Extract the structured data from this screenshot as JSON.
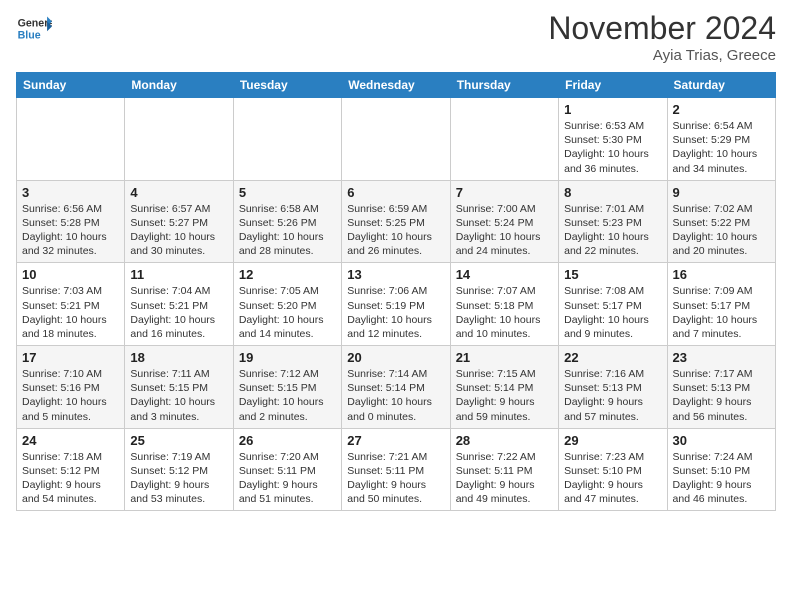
{
  "header": {
    "logo_line1": "General",
    "logo_line2": "Blue",
    "month_year": "November 2024",
    "location": "Ayia Trias, Greece"
  },
  "weekdays": [
    "Sunday",
    "Monday",
    "Tuesday",
    "Wednesday",
    "Thursday",
    "Friday",
    "Saturday"
  ],
  "weeks": [
    [
      {
        "day": "",
        "info": ""
      },
      {
        "day": "",
        "info": ""
      },
      {
        "day": "",
        "info": ""
      },
      {
        "day": "",
        "info": ""
      },
      {
        "day": "",
        "info": ""
      },
      {
        "day": "1",
        "info": "Sunrise: 6:53 AM\nSunset: 5:30 PM\nDaylight: 10 hours and 36 minutes."
      },
      {
        "day": "2",
        "info": "Sunrise: 6:54 AM\nSunset: 5:29 PM\nDaylight: 10 hours and 34 minutes."
      }
    ],
    [
      {
        "day": "3",
        "info": "Sunrise: 6:56 AM\nSunset: 5:28 PM\nDaylight: 10 hours and 32 minutes."
      },
      {
        "day": "4",
        "info": "Sunrise: 6:57 AM\nSunset: 5:27 PM\nDaylight: 10 hours and 30 minutes."
      },
      {
        "day": "5",
        "info": "Sunrise: 6:58 AM\nSunset: 5:26 PM\nDaylight: 10 hours and 28 minutes."
      },
      {
        "day": "6",
        "info": "Sunrise: 6:59 AM\nSunset: 5:25 PM\nDaylight: 10 hours and 26 minutes."
      },
      {
        "day": "7",
        "info": "Sunrise: 7:00 AM\nSunset: 5:24 PM\nDaylight: 10 hours and 24 minutes."
      },
      {
        "day": "8",
        "info": "Sunrise: 7:01 AM\nSunset: 5:23 PM\nDaylight: 10 hours and 22 minutes."
      },
      {
        "day": "9",
        "info": "Sunrise: 7:02 AM\nSunset: 5:22 PM\nDaylight: 10 hours and 20 minutes."
      }
    ],
    [
      {
        "day": "10",
        "info": "Sunrise: 7:03 AM\nSunset: 5:21 PM\nDaylight: 10 hours and 18 minutes."
      },
      {
        "day": "11",
        "info": "Sunrise: 7:04 AM\nSunset: 5:21 PM\nDaylight: 10 hours and 16 minutes."
      },
      {
        "day": "12",
        "info": "Sunrise: 7:05 AM\nSunset: 5:20 PM\nDaylight: 10 hours and 14 minutes."
      },
      {
        "day": "13",
        "info": "Sunrise: 7:06 AM\nSunset: 5:19 PM\nDaylight: 10 hours and 12 minutes."
      },
      {
        "day": "14",
        "info": "Sunrise: 7:07 AM\nSunset: 5:18 PM\nDaylight: 10 hours and 10 minutes."
      },
      {
        "day": "15",
        "info": "Sunrise: 7:08 AM\nSunset: 5:17 PM\nDaylight: 10 hours and 9 minutes."
      },
      {
        "day": "16",
        "info": "Sunrise: 7:09 AM\nSunset: 5:17 PM\nDaylight: 10 hours and 7 minutes."
      }
    ],
    [
      {
        "day": "17",
        "info": "Sunrise: 7:10 AM\nSunset: 5:16 PM\nDaylight: 10 hours and 5 minutes."
      },
      {
        "day": "18",
        "info": "Sunrise: 7:11 AM\nSunset: 5:15 PM\nDaylight: 10 hours and 3 minutes."
      },
      {
        "day": "19",
        "info": "Sunrise: 7:12 AM\nSunset: 5:15 PM\nDaylight: 10 hours and 2 minutes."
      },
      {
        "day": "20",
        "info": "Sunrise: 7:14 AM\nSunset: 5:14 PM\nDaylight: 10 hours and 0 minutes."
      },
      {
        "day": "21",
        "info": "Sunrise: 7:15 AM\nSunset: 5:14 PM\nDaylight: 9 hours and 59 minutes."
      },
      {
        "day": "22",
        "info": "Sunrise: 7:16 AM\nSunset: 5:13 PM\nDaylight: 9 hours and 57 minutes."
      },
      {
        "day": "23",
        "info": "Sunrise: 7:17 AM\nSunset: 5:13 PM\nDaylight: 9 hours and 56 minutes."
      }
    ],
    [
      {
        "day": "24",
        "info": "Sunrise: 7:18 AM\nSunset: 5:12 PM\nDaylight: 9 hours and 54 minutes."
      },
      {
        "day": "25",
        "info": "Sunrise: 7:19 AM\nSunset: 5:12 PM\nDaylight: 9 hours and 53 minutes."
      },
      {
        "day": "26",
        "info": "Sunrise: 7:20 AM\nSunset: 5:11 PM\nDaylight: 9 hours and 51 minutes."
      },
      {
        "day": "27",
        "info": "Sunrise: 7:21 AM\nSunset: 5:11 PM\nDaylight: 9 hours and 50 minutes."
      },
      {
        "day": "28",
        "info": "Sunrise: 7:22 AM\nSunset: 5:11 PM\nDaylight: 9 hours and 49 minutes."
      },
      {
        "day": "29",
        "info": "Sunrise: 7:23 AM\nSunset: 5:10 PM\nDaylight: 9 hours and 47 minutes."
      },
      {
        "day": "30",
        "info": "Sunrise: 7:24 AM\nSunset: 5:10 PM\nDaylight: 9 hours and 46 minutes."
      }
    ]
  ]
}
